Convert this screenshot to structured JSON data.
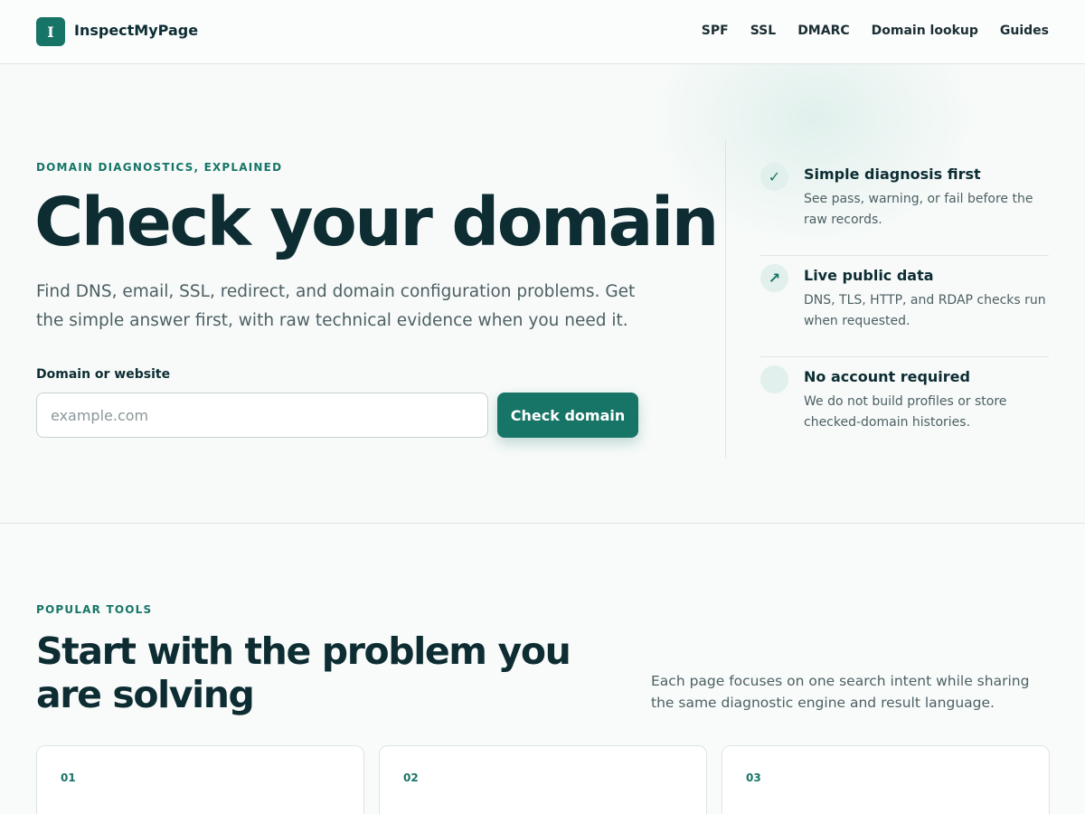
{
  "header": {
    "logo_letter": "I",
    "brand": "InspectMyPage",
    "nav": [
      "SPF",
      "SSL",
      "DMARC",
      "Domain lookup",
      "Guides"
    ]
  },
  "hero": {
    "eyebrow": "DOMAIN DIAGNOSTICS, EXPLAINED",
    "title": "Check your domain",
    "subtitle": "Find DNS, email, SSL, redirect, and domain configuration problems. Get the simple answer first, with raw technical evidence when you need it.",
    "field_label": "Domain or website",
    "input_placeholder": "example.com",
    "input_value": "",
    "button_label": "Check domain"
  },
  "features": [
    {
      "icon": "check-icon",
      "glyph": "✓",
      "title": "Simple diagnosis first",
      "desc": "See pass, warning, or fail before the raw records."
    },
    {
      "icon": "arrow-up-right-icon",
      "glyph": "↗",
      "title": "Live public data",
      "desc": "DNS, TLS, HTTP, and RDAP checks run when requested."
    },
    {
      "icon": "circle-icon",
      "glyph": "",
      "title": "No account required",
      "desc": "We do not build profiles or store checked-domain histories."
    }
  ],
  "tools": {
    "eyebrow": "POPULAR TOOLS",
    "title": "Start with the problem you are solving",
    "desc": "Each page focuses on one search intent while sharing the same diagnostic engine and result language.",
    "cards": [
      {
        "num": "01"
      },
      {
        "num": "02"
      },
      {
        "num": "03"
      }
    ]
  },
  "colors": {
    "accent": "#177567",
    "text": "#0d2d33",
    "muted": "#4d5f63"
  }
}
